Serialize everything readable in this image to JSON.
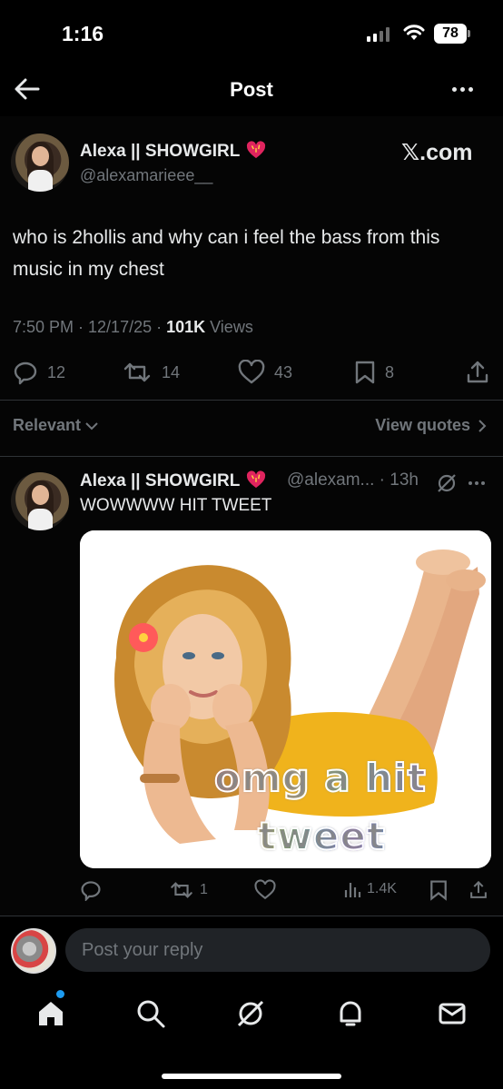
{
  "status_bar": {
    "time": "1:16",
    "battery": "78"
  },
  "header": {
    "title": "Post"
  },
  "post": {
    "author_name": "Alexa || SHOWGIRL",
    "author_handle": "@alexamarieee__",
    "source_label": "𝕏.com",
    "text": "who is 2hollis and why can i feel the bass from this music in my chest",
    "timestamp": "7:50 PM · 12/17/25 · ",
    "views_count": "101K",
    "views_label": " Views",
    "stats": {
      "replies": "12",
      "reposts": "14",
      "likes": "43",
      "bookmarks": "8"
    }
  },
  "sort": {
    "relevant_label": "Relevant",
    "view_quotes_label": "View quotes"
  },
  "reply": {
    "author_name": "Alexa || SHOWGIRL",
    "handle_time": "@alexam... · 13h",
    "text": "WOWWWW HIT TWEET",
    "image_caption_line1": "omg a hit",
    "image_caption_line2": "tweet",
    "stats": {
      "reposts": "1",
      "views": "1.4K"
    }
  },
  "composer": {
    "placeholder": "Post your reply"
  },
  "icons": [
    "back-arrow-icon",
    "more-icon",
    "heart-emoji-icon",
    "reply-icon",
    "repost-icon",
    "like-icon",
    "bookmark-icon",
    "share-icon",
    "chevron-down-icon",
    "chevron-right-icon",
    "grok-icon",
    "views-icon",
    "home-icon",
    "search-icon",
    "notifications-icon",
    "messages-icon"
  ],
  "colors": {
    "background": "#000000",
    "text": "#e7e9ea",
    "secondary": "#71767b",
    "accent": "#1d9bf0",
    "divider": "#2f3336"
  }
}
